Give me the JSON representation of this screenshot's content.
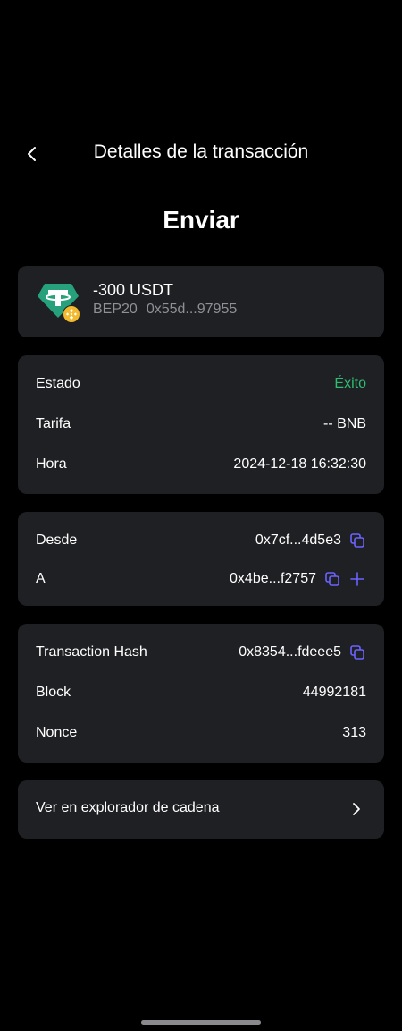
{
  "header": {
    "title": "Detalles de la transacción"
  },
  "page_title": "Enviar",
  "token": {
    "amount": "-300 USDT",
    "network": "BEP20",
    "contract": "0x55d...97955",
    "logo_icon": "tether-icon",
    "badge_icon": "bnb-chain-icon",
    "logo_color": "#26a17b",
    "badge_color": "#f3ba2f"
  },
  "status": {
    "state_label": "Estado",
    "state_value": "Éxito",
    "state_color": "#2ebd72",
    "fee_label": "Tarifa",
    "fee_value": "-- BNB",
    "time_label": "Hora",
    "time_value": "2024-12-18 16:32:30"
  },
  "addresses": {
    "from_label": "Desde",
    "from_value": "0x7cf...4d5e3",
    "to_label": "A",
    "to_value": "0x4be...f2757"
  },
  "details": {
    "hash_label": "Transaction Hash",
    "hash_value": "0x8354...fdeee5",
    "block_label": "Block",
    "block_value": "44992181",
    "nonce_label": "Nonce",
    "nonce_value": "313"
  },
  "explorer": {
    "label": "Ver en explorador de cadena"
  },
  "accent_color": "#6c63ff"
}
